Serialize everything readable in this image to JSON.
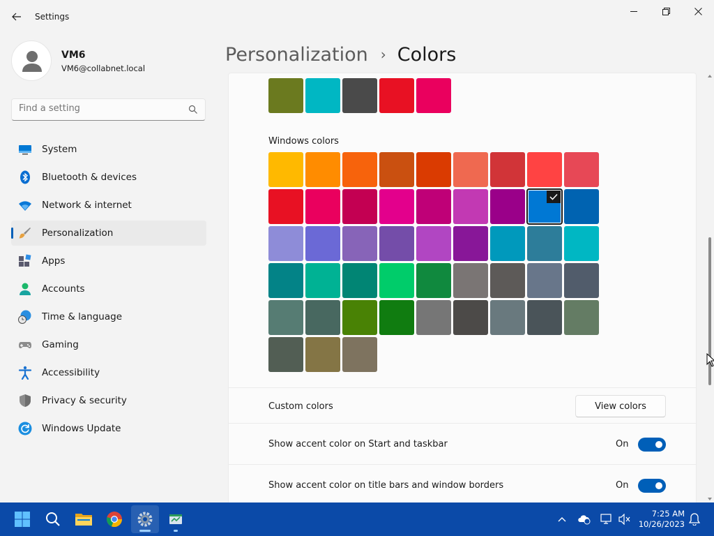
{
  "window": {
    "title": "Settings",
    "minimize_glyph": "—",
    "restore_glyph": "❐",
    "close_glyph": "✕"
  },
  "profile": {
    "name": "VM6",
    "email": "VM6@collabnet.local"
  },
  "search": {
    "placeholder": "Find a setting"
  },
  "sidebar": {
    "items": [
      {
        "label": "System",
        "icon": "monitor-icon"
      },
      {
        "label": "Bluetooth & devices",
        "icon": "bluetooth-icon"
      },
      {
        "label": "Network & internet",
        "icon": "wifi-icon"
      },
      {
        "label": "Personalization",
        "icon": "brush-icon",
        "active": true
      },
      {
        "label": "Apps",
        "icon": "apps-icon"
      },
      {
        "label": "Accounts",
        "icon": "person-icon"
      },
      {
        "label": "Time & language",
        "icon": "clock-globe-icon"
      },
      {
        "label": "Gaming",
        "icon": "gamepad-icon"
      },
      {
        "label": "Accessibility",
        "icon": "accessibility-icon"
      },
      {
        "label": "Privacy & security",
        "icon": "shield-icon"
      },
      {
        "label": "Windows Update",
        "icon": "refresh-icon"
      }
    ]
  },
  "header": {
    "parent": "Personalization",
    "separator": "›",
    "current": "Colors"
  },
  "recent_colors": [
    "#6b7a1f",
    "#00b7c3",
    "#4a4a4a",
    "#e81123",
    "#ea005e"
  ],
  "windows_colors": {
    "label": "Windows colors",
    "selected_index": 16,
    "colors": [
      "#ffb900",
      "#ff8c00",
      "#f7630c",
      "#ca5010",
      "#da3b01",
      "#ef6950",
      "#d13438",
      "#ff4343",
      "#e74856",
      "#e81123",
      "#ea005e",
      "#c30052",
      "#e3008c",
      "#bf0077",
      "#c239b3",
      "#9a0089",
      "#0078d4",
      "#0063b1",
      "#8e8cd8",
      "#6b69d6",
      "#8764b8",
      "#744da9",
      "#b146c2",
      "#881798",
      "#0099bc",
      "#2d7d9a",
      "#00b7c3",
      "#038387",
      "#00b294",
      "#018574",
      "#00cc6a",
      "#10893e",
      "#7a7574",
      "#5d5a58",
      "#68768a",
      "#515c6b",
      "#567c73",
      "#486860",
      "#498205",
      "#107c10",
      "#767676",
      "#4c4a48",
      "#69797e",
      "#4a5459",
      "#647c64",
      "#525e54",
      "#847545",
      "#7e735f"
    ]
  },
  "custom_colors": {
    "label": "Custom colors",
    "button": "View colors"
  },
  "toggles": [
    {
      "label": "Show accent color on Start and taskbar",
      "state": "On",
      "on": true
    },
    {
      "label": "Show accent color on title bars and window borders",
      "state": "On",
      "on": true
    }
  ],
  "taskbar": {
    "apps": [
      "start-icon",
      "search-icon",
      "file-explorer-icon",
      "chrome-icon",
      "settings-icon",
      "app-icon"
    ],
    "time": "7:25 AM",
    "date": "10/26/2023"
  }
}
